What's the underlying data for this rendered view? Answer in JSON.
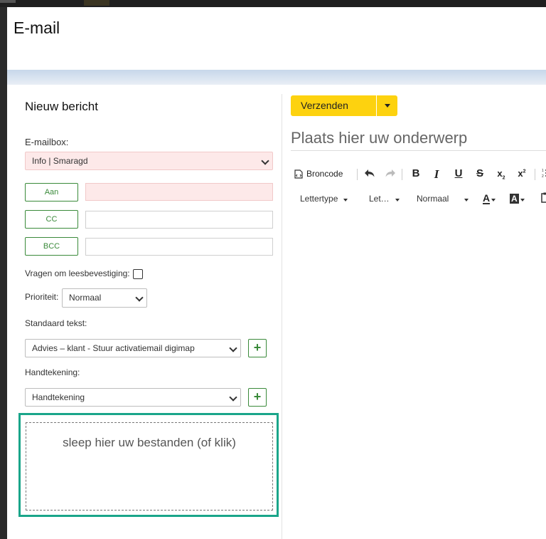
{
  "window": {
    "title": "E-mail"
  },
  "compose": {
    "heading": "Nieuw bericht",
    "mailbox_label": "E-mailbox:",
    "mailbox_value": "Info | Smaragd",
    "to_button": "Aan",
    "cc_button": "CC",
    "bcc_button": "BCC",
    "read_receipt_label": "Vragen om leesbevestiging:",
    "priority_label": "Prioriteit:",
    "priority_value": "Normaal",
    "standard_text_label": "Standaard tekst:",
    "standard_text_value": "Advies – klant - Stuur activatiemail digimap",
    "signature_label": "Handtekening:",
    "signature_value": "Handtekening",
    "dropzone_text": "sleep hier uw bestanden (of klik)"
  },
  "editor": {
    "send_label": "Verzenden",
    "subject_placeholder": "Plaats hier uw onderwerp",
    "source_label": "Broncode",
    "font_label": "Lettertype",
    "size_label": "Let…",
    "format_label": "Normaal",
    "bold": "B",
    "italic": "I",
    "underline": "U",
    "strike": "S"
  },
  "colors": {
    "accent_yellow": "#fdd20f",
    "green": "#3a8a3a",
    "teal_highlight": "#1aa58a",
    "required_pink": "#fde9e9"
  }
}
